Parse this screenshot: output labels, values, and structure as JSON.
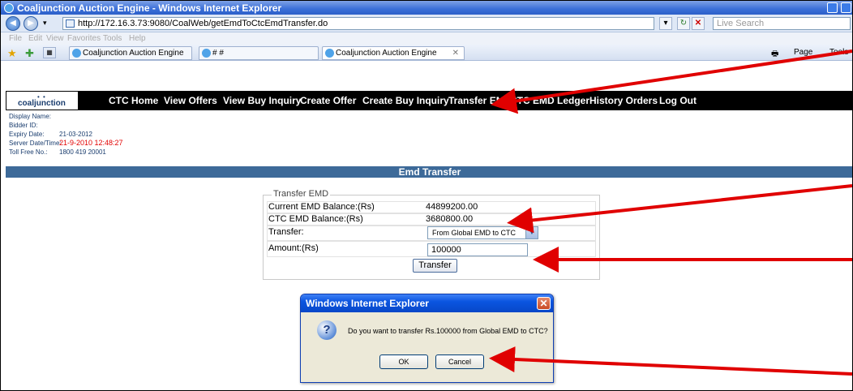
{
  "window": {
    "title": "Coaljunction Auction Engine - Windows Internet Explorer"
  },
  "browser": {
    "url": "http://172.16.3.73:9080/CoalWeb/getEmdToCtcEmdTransfer.do",
    "search_placeholder": "Live Search",
    "menu": [
      "File",
      "Edit",
      "View",
      "Favorites",
      "Tools",
      "Help"
    ],
    "tabs": [
      "Coaljunction Auction Engine",
      "# #",
      "Coaljunction Auction Engine"
    ],
    "toolbar": {
      "page": "Page",
      "tools": "Tools"
    }
  },
  "app": {
    "logo": "coaljunction",
    "nav": [
      "CTC Home",
      "View Offers",
      "View Buy Inquiry",
      "Create Offer",
      "Create Buy Inquiry",
      "Transfer EMD",
      "CTC EMD Ledger",
      "History Orders",
      "Log Out"
    ],
    "info": {
      "display_name_label": "Display Name:",
      "bidder_id_label": "Bidder ID:",
      "expiry_label": "Expiry Date:",
      "expiry_value": "21-03-2012",
      "server_label": "Server Date/Time:",
      "server_value": "21-9-2010 12:48:27",
      "tollfree_label": "Toll Free No.:",
      "tollfree_value": "1800 419 20001"
    },
    "section_title": "Emd Transfer",
    "form": {
      "legend": "Transfer EMD",
      "current_label": "Current EMD Balance:(Rs)",
      "current_value": "44899200.00",
      "ctc_label": "CTC EMD Balance:(Rs)",
      "ctc_value": "3680800.00",
      "transfer_label": "Transfer:",
      "transfer_selected": "From Global EMD to CTC",
      "amount_label": "Amount:(Rs)",
      "amount_value": "100000",
      "submit_label": "Transfer"
    }
  },
  "dialog": {
    "title": "Windows Internet Explorer",
    "message": "Do you want to transfer Rs.100000 from Global EMD to CTC?",
    "ok": "OK",
    "cancel": "Cancel"
  },
  "colors": {
    "nav_bg": "#000000",
    "section_bar": "#3d6a99",
    "arrow": "#e00000",
    "server_time": "#e20000"
  }
}
